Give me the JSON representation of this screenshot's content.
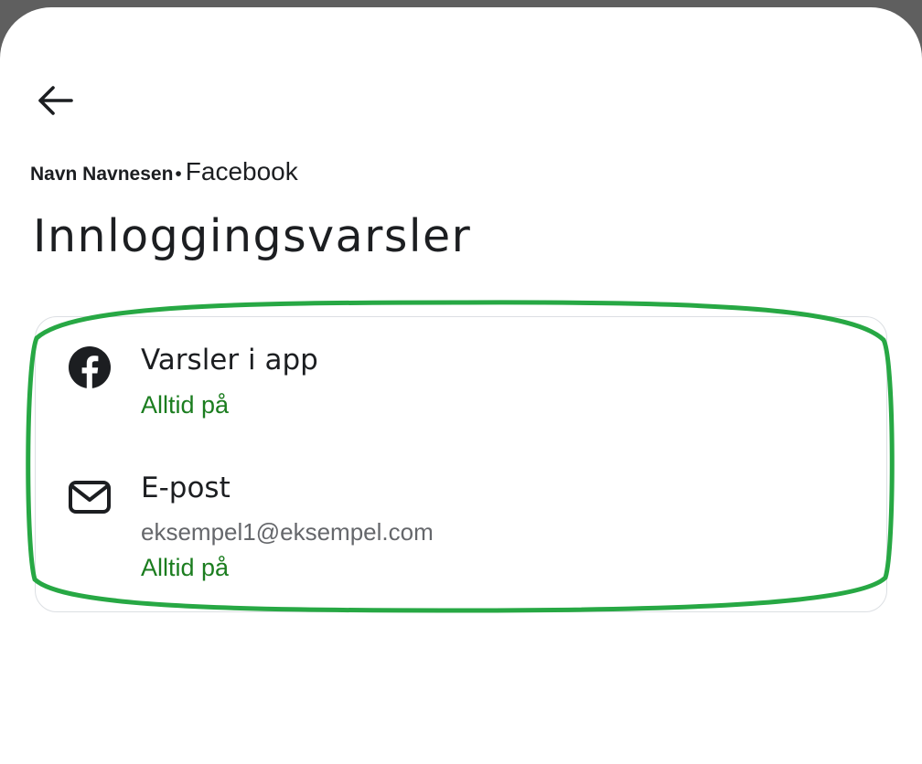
{
  "header": {
    "account_name": "Navn Navnesen",
    "separator": "•",
    "platform": "Facebook",
    "title": "Innloggingsvarsler"
  },
  "options": {
    "in_app": {
      "icon": "facebook-icon",
      "title": "Varsler i app",
      "status": "Alltid på"
    },
    "email": {
      "icon": "envelope-icon",
      "title": "E-post",
      "address": "eksempel1@eksempel.com",
      "status": "Alltid på"
    }
  },
  "colors": {
    "status_green": "#1b7d1f",
    "highlight_green": "#27a844",
    "text_dark": "#1c1e21",
    "text_muted": "#65676b"
  }
}
